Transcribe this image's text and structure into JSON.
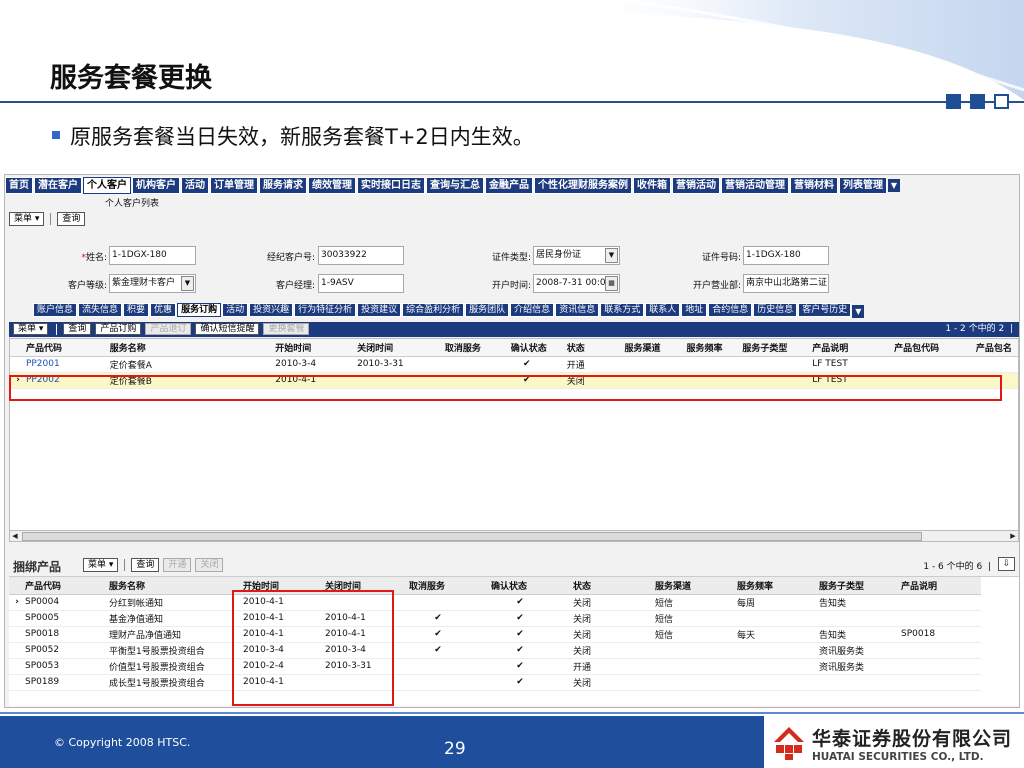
{
  "slide": {
    "title": "服务套餐更换",
    "bullet": "原服务套餐当日失效，新服务套餐T+2日内生效。",
    "copyright": "© Copyright 2008 HTSC.",
    "page_number": "29",
    "logo_cn": "华泰证券股份有限公司",
    "logo_en": "HUATAI SECURITIES CO., LTD."
  },
  "app": {
    "main_tabs": [
      "首页",
      "潜在客户",
      "个人客户",
      "机构客户",
      "活动",
      "订单管理",
      "服务请求",
      "绩效管理",
      "实时接口日志",
      "查询与汇总",
      "金融产品",
      "个性化理财服务案例",
      "收件箱",
      "营销活动",
      "营销活动管理",
      "营销材料",
      "列表管理"
    ],
    "active_main_tab": 2,
    "sub_label": "个人客户列表",
    "menu_btn": "菜单",
    "query_btn": "查询",
    "form": {
      "name_label": "姓名",
      "name_value": "1-1DGX-180",
      "broker_no_label": "经纪客户号",
      "broker_no_value": "30033922",
      "id_type_label": "证件类型",
      "id_type_value": "居民身份证",
      "id_no_label": "证件号码",
      "id_no_value": "1-1DGX-180",
      "level_label": "客户等级",
      "level_value": "紫金理财卡客户",
      "manager_label": "客户经理",
      "manager_value": "1-9ASV",
      "open_time_label": "开户时间",
      "open_time_value": "2008-7-31 00:00",
      "branch_label": "开户营业部",
      "branch_value": "南京中山北路第二证"
    },
    "sub_tabs": [
      "账户信息",
      "流失信息",
      "积要",
      "优惠",
      "服务订购",
      "活动",
      "投资兴趣",
      "行为特征分析",
      "投资建议",
      "综合盈利分析",
      "服务团队",
      "介绍信息",
      "资讯信息",
      "联系方式",
      "联系人",
      "地址",
      "合约信息",
      "历史信息",
      "客户号历史"
    ],
    "active_sub_tab": 4,
    "grid1_toolbar": {
      "buttons": [
        "产品订购",
        "产品退订",
        "确认短信提醒",
        "更换套餐"
      ],
      "count": "1 - 2 个中的 2"
    },
    "grid1": {
      "columns": [
        "产品代码",
        "服务名称",
        "开始时间",
        "关闭时间",
        "取消服务",
        "确认状态",
        "状态",
        "服务渠道",
        "服务频率",
        "服务子类型",
        "产品说明",
        "产品包代码",
        "产品包名"
      ],
      "rows": [
        {
          "marker": "",
          "code": "PP2001",
          "name": "定价套餐A",
          "start": "2010-3-4",
          "end": "2010-3-31",
          "cancel": "",
          "confirm": "✔",
          "status": "开通",
          "channel": "",
          "freq": "",
          "subtype": "",
          "desc": "LF TEST",
          "pkg": "",
          "pkgname": ""
        },
        {
          "marker": "›",
          "code": "PP2002",
          "name": "定价套餐B",
          "start": "2010-4-1",
          "end": "",
          "cancel": "",
          "confirm": "✔",
          "status": "关闭",
          "channel": "",
          "freq": "",
          "subtype": "",
          "desc": "LF TEST",
          "pkg": "",
          "pkgname": ""
        }
      ]
    },
    "grid2_bar": {
      "label": "捆绑产品",
      "buttons": [
        "开通",
        "关闭"
      ],
      "count": "1 - 6 个中的 6"
    },
    "grid2": {
      "columns": [
        "产品代码",
        "服务名称",
        "开始时间",
        "关闭时间",
        "取消服务",
        "确认状态",
        "状态",
        "服务渠道",
        "服务频率",
        "服务子类型",
        "产品说明"
      ],
      "rows": [
        {
          "marker": "›",
          "code": "SP0004",
          "name": "分红到帐通知",
          "start": "2010-4-1",
          "end": "",
          "cancel": "",
          "confirm": "✔",
          "status": "关闭",
          "channel": "短信",
          "freq": "每周",
          "subtype": "告知类",
          "desc": ""
        },
        {
          "marker": "",
          "code": "SP0005",
          "name": "基金净值通知",
          "start": "2010-4-1",
          "end": "2010-4-1",
          "cancel": "✔",
          "confirm": "✔",
          "status": "关闭",
          "channel": "短信",
          "freq": "",
          "subtype": "",
          "desc": ""
        },
        {
          "marker": "",
          "code": "SP0018",
          "name": "理财产品净值通知",
          "start": "2010-4-1",
          "end": "2010-4-1",
          "cancel": "✔",
          "confirm": "✔",
          "status": "关闭",
          "channel": "短信",
          "freq": "每天",
          "subtype": "告知类",
          "desc": "SP0018"
        },
        {
          "marker": "",
          "code": "SP0052",
          "name": "平衡型1号股票投资组合",
          "start": "2010-3-4",
          "end": "2010-3-4",
          "cancel": "✔",
          "confirm": "✔",
          "status": "关闭",
          "channel": "",
          "freq": "",
          "subtype": "资讯服务类",
          "desc": ""
        },
        {
          "marker": "",
          "code": "SP0053",
          "name": "价值型1号股票投资组合",
          "start": "2010-2-4",
          "end": "2010-3-31",
          "cancel": "",
          "confirm": "✔",
          "status": "开通",
          "channel": "",
          "freq": "",
          "subtype": "资讯服务类",
          "desc": ""
        },
        {
          "marker": "",
          "code": "SP0189",
          "name": "成长型1号股票投资组合",
          "start": "2010-4-1",
          "end": "",
          "cancel": "",
          "confirm": "✔",
          "status": "关闭",
          "channel": "",
          "freq": "",
          "subtype": "",
          "desc": ""
        }
      ]
    }
  },
  "colors": {
    "tab_blue": "#1c3a7e",
    "highlight_red": "#e01818",
    "selected_row": "#fbf7c6",
    "footer_blue": "#1f4e9c"
  }
}
